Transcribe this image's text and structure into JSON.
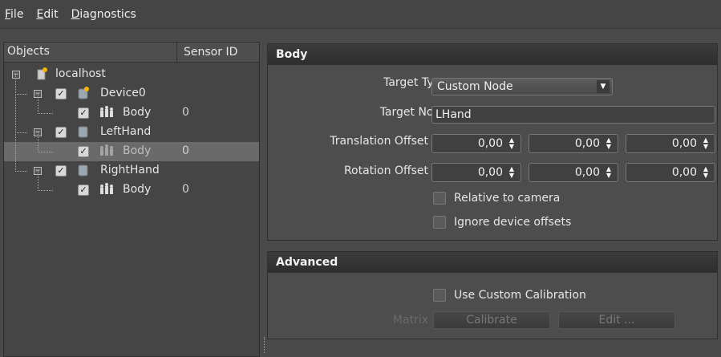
{
  "menu": {
    "file_u": "F",
    "file_rest": "ile",
    "edit_u": "E",
    "edit_rest": "dit",
    "diag_u": "D",
    "diag_rest": "iagnostics"
  },
  "tree": {
    "col_objects": "Objects",
    "col_sensor": "Sensor ID",
    "nodes": [
      {
        "label": "localhost",
        "sensor": ""
      },
      {
        "label": "Device0",
        "sensor": ""
      },
      {
        "label": "Body",
        "sensor": "0"
      },
      {
        "label": "LeftHand",
        "sensor": ""
      },
      {
        "label": "Body",
        "sensor": "0"
      },
      {
        "label": "RightHand",
        "sensor": ""
      },
      {
        "label": "Body",
        "sensor": "0"
      }
    ],
    "selected_index": 4
  },
  "body_section": {
    "title": "Body",
    "target_type_label": "Target Type",
    "target_type_value": "Custom Node",
    "target_node_label": "Target Node",
    "target_node_value": "LHand",
    "translation_label": "Translation Offset",
    "translation_values": [
      "0,00",
      "0,00",
      "0,00"
    ],
    "rotation_label": "Rotation Offset",
    "rotation_values": [
      "0,00",
      "0,00",
      "0,00"
    ],
    "relative_to_camera": "Relative to camera",
    "ignore_offsets": "Ignore device offsets"
  },
  "advanced_section": {
    "title": "Advanced",
    "use_custom_calibration": "Use Custom Calibration",
    "matrix_label": "Matrix",
    "calibrate_button": "Calibrate",
    "edit_button": "Edit ..."
  },
  "icons": {
    "host": "server-icon",
    "device": "device-icon",
    "body": "body-icon"
  }
}
